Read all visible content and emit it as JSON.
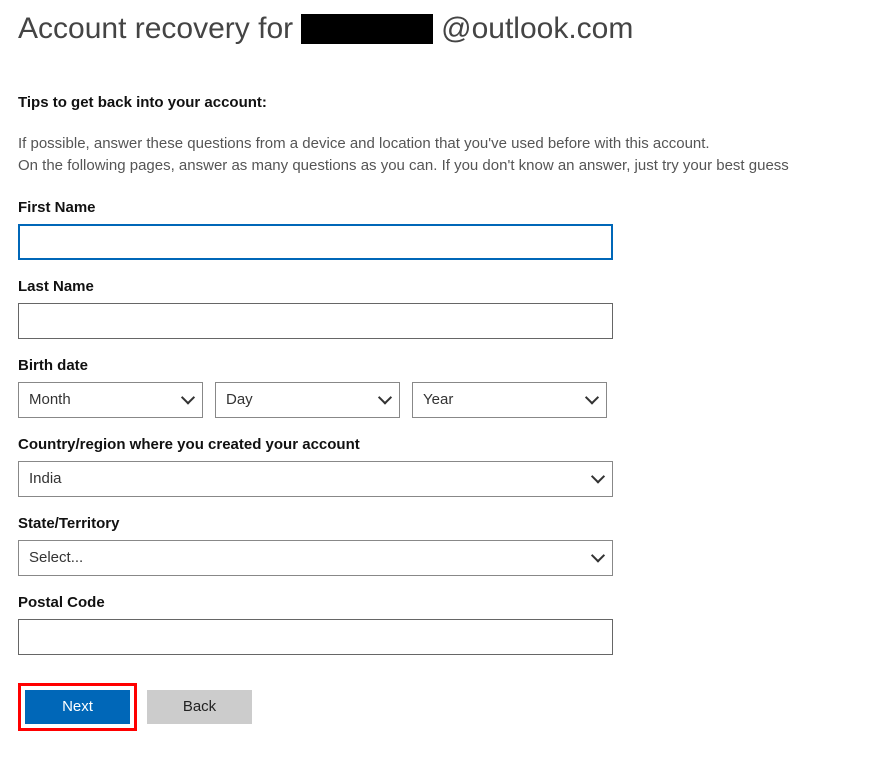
{
  "header": {
    "title_prefix": "Account recovery for ",
    "email_suffix": "@outlook.com"
  },
  "tips": {
    "heading": "Tips to get back into your account:",
    "line1": "If possible, answer these questions from a device and location that you've used before with this account.",
    "line2": "On the following pages, answer as many questions as you can. If you don't know an answer, just try your best guess"
  },
  "form": {
    "first_name": {
      "label": "First Name",
      "value": ""
    },
    "last_name": {
      "label": "Last Name",
      "value": ""
    },
    "birth_date": {
      "label": "Birth date",
      "month": "Month",
      "day": "Day",
      "year": "Year"
    },
    "country": {
      "label": "Country/region where you created your account",
      "value": "India"
    },
    "state": {
      "label": "State/Territory",
      "value": "Select..."
    },
    "postal": {
      "label": "Postal Code",
      "value": ""
    }
  },
  "buttons": {
    "next": "Next",
    "back": "Back"
  }
}
